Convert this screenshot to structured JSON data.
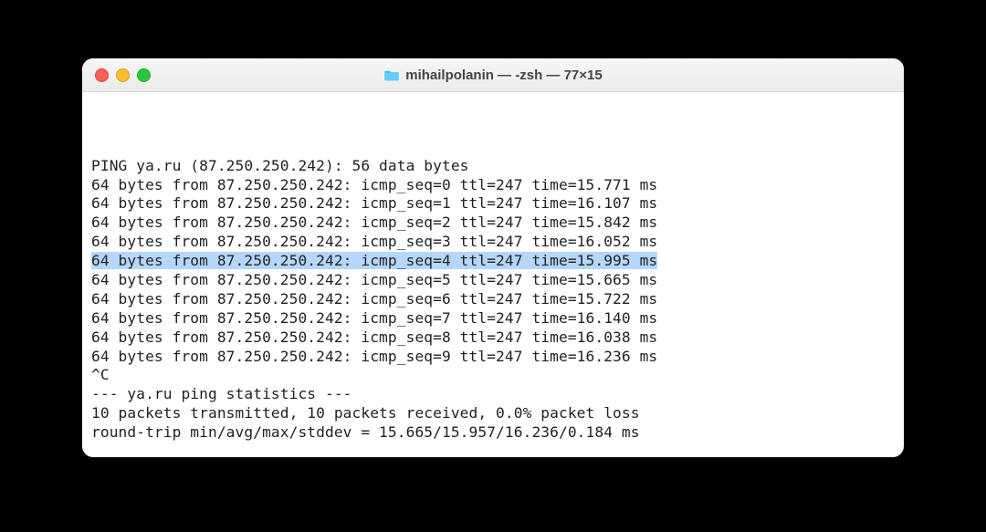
{
  "window": {
    "title": "mihailpolanin — -zsh — 77×15",
    "home_icon_label": "home-folder-icon"
  },
  "terminal": {
    "ping_header": "PING ya.ru (87.250.250.242): 56 data bytes",
    "responses": [
      "64 bytes from 87.250.250.242: icmp_seq=0 ttl=247 time=15.771 ms",
      "64 bytes from 87.250.250.242: icmp_seq=1 ttl=247 time=16.107 ms",
      "64 bytes from 87.250.250.242: icmp_seq=2 ttl=247 time=15.842 ms",
      "64 bytes from 87.250.250.242: icmp_seq=3 ttl=247 time=16.052 ms",
      "64 bytes from 87.250.250.242: icmp_seq=4 ttl=247 time=15.995 ms",
      "64 bytes from 87.250.250.242: icmp_seq=5 ttl=247 time=15.665 ms",
      "64 bytes from 87.250.250.242: icmp_seq=6 ttl=247 time=15.722 ms",
      "64 bytes from 87.250.250.242: icmp_seq=7 ttl=247 time=16.140 ms",
      "64 bytes from 87.250.250.242: icmp_seq=8 ttl=247 time=16.038 ms",
      "64 bytes from 87.250.250.242: icmp_seq=9 ttl=247 time=16.236 ms"
    ],
    "highlighted_index": 4,
    "interrupt": "^C",
    "stats_header": "--- ya.ru ping statistics ---",
    "stats_line1": "10 packets transmitted, 10 packets received, 0.0% packet loss",
    "stats_line2": "round-trip min/avg/max/stddev = 15.665/15.957/16.236/0.184 ms"
  },
  "traffic_buttons": {
    "close": "close",
    "minimize": "minimize",
    "maximize": "maximize"
  }
}
